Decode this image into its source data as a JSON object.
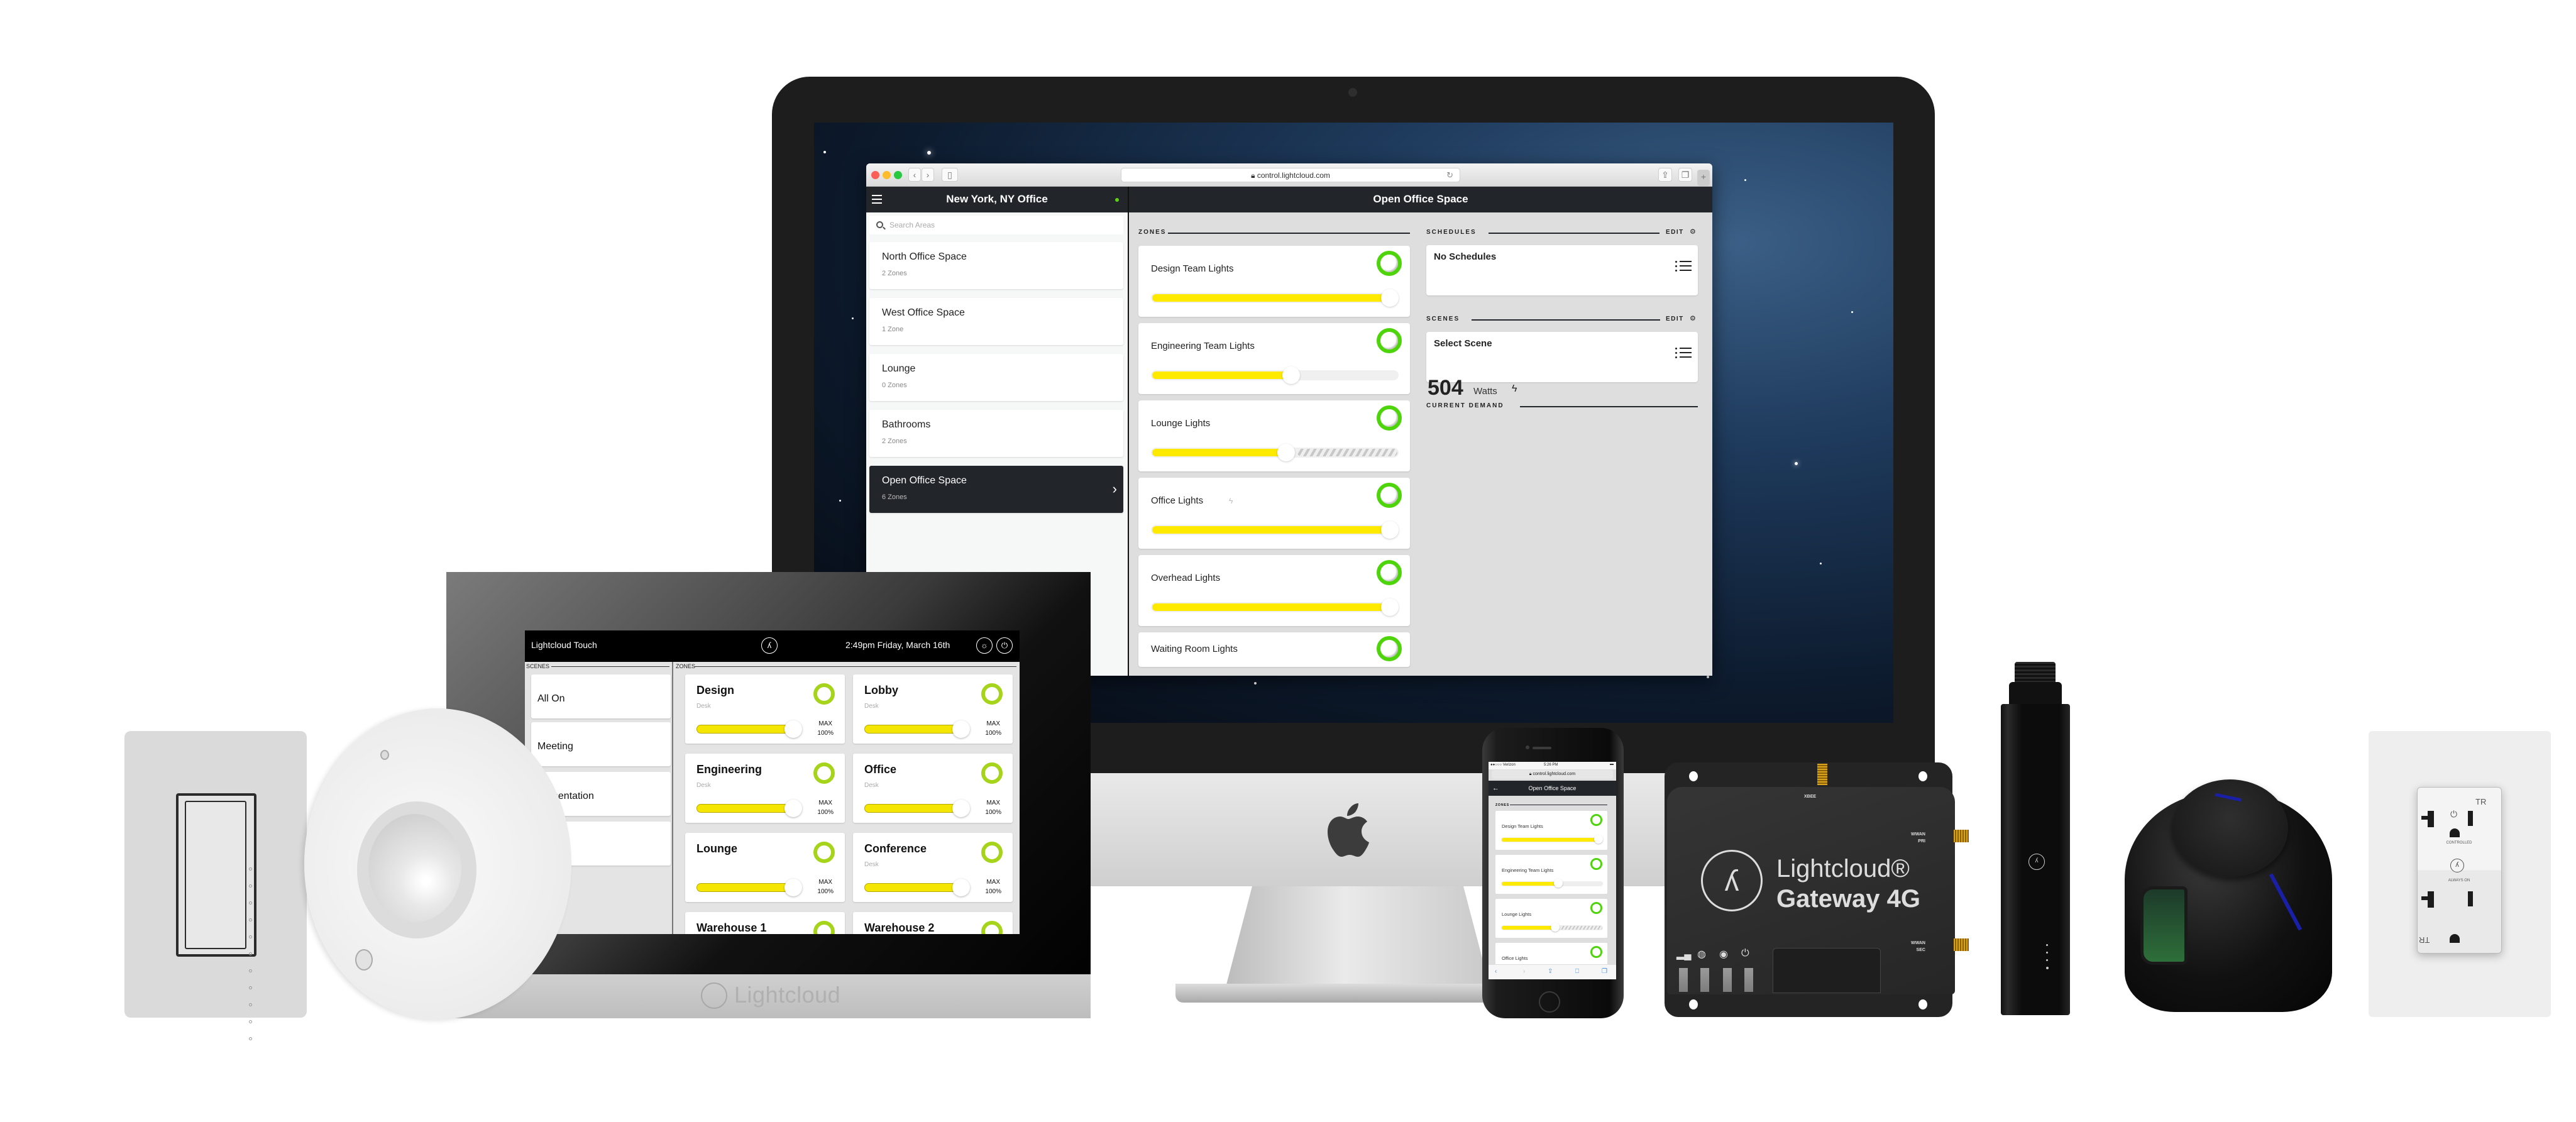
{
  "desktop_browser": {
    "url": "control.lightcloud.com",
    "site_title": "New York, NY Office",
    "connection_status_color": "#5fd312",
    "area_title": "Open Office Space",
    "search": {
      "placeholder": "Search Areas"
    },
    "areas": [
      {
        "name": "North Office Space",
        "zones": "2 Zones",
        "active": false
      },
      {
        "name": "West Office Space",
        "zones": "1 Zone",
        "active": false
      },
      {
        "name": "Lounge",
        "zones": "0 Zones",
        "active": false
      },
      {
        "name": "Bathrooms",
        "zones": "2 Zones",
        "active": false
      },
      {
        "name": "Open Office Space",
        "zones": "6 Zones",
        "active": true
      }
    ],
    "zones_label": "ZONES",
    "zones": [
      {
        "name": "Design Team Lights",
        "level_percent": 100,
        "limit_percent": null,
        "on": true,
        "power_icon": false
      },
      {
        "name": "Engineering Team Lights",
        "level_percent": 58,
        "limit_percent": null,
        "on": true,
        "power_icon": false
      },
      {
        "name": "Lounge Lights",
        "level_percent": 56,
        "limit_percent": 56,
        "on": true,
        "power_icon": false
      },
      {
        "name": "Office Lights",
        "level_percent": 100,
        "limit_percent": null,
        "on": true,
        "power_icon": true
      },
      {
        "name": "Overhead Lights",
        "level_percent": 100,
        "limit_percent": null,
        "on": true,
        "power_icon": false
      },
      {
        "name": "Waiting Room Lights",
        "level_percent": null,
        "limit_percent": null,
        "on": true,
        "power_icon": false
      }
    ],
    "schedules": {
      "label": "SCHEDULES",
      "edit_label": "EDIT",
      "card_title": "No Schedules"
    },
    "scenes": {
      "label": "SCENES",
      "edit_label": "EDIT",
      "card_title": "Select Scene"
    },
    "current_demand": {
      "label": "CURRENT DEMAND",
      "value": "504",
      "unit": "Watts"
    },
    "accent_colors": {
      "slider_fill": "#fee900",
      "on_ring": "#4ed40a",
      "header_bg": "#22262b"
    }
  },
  "touch_panel": {
    "title": "Lightcloud Touch",
    "datetime": "2:49pm Friday, March 16th",
    "scenes_label": "SCENES",
    "zones_label": "ZONES",
    "scenes": [
      "All On",
      "Meeting",
      "Presentation",
      ""
    ],
    "zones": [
      {
        "name": "Design",
        "sub": "Desk",
        "max_label": "MAX",
        "level": "100%"
      },
      {
        "name": "Lobby",
        "sub": "Desk",
        "max_label": "MAX",
        "level": "100%"
      },
      {
        "name": "Engineering",
        "sub": "Desk",
        "max_label": "MAX",
        "level": "100%"
      },
      {
        "name": "Office",
        "sub": "Desk",
        "max_label": "MAX",
        "level": "100%"
      },
      {
        "name": "Lounge",
        "sub": "",
        "max_label": "MAX",
        "level": "100%"
      },
      {
        "name": "Conference",
        "sub": "Desk",
        "max_label": "MAX",
        "level": "100%"
      },
      {
        "name": "Warehouse 1",
        "sub": "",
        "max_label": "",
        "level": ""
      },
      {
        "name": "Warehouse 2",
        "sub": "",
        "max_label": "",
        "level": ""
      }
    ],
    "brand": "Lightcloud"
  },
  "phone": {
    "carrier": "●●○○○ Verizon",
    "time": "5:26 PM",
    "url": "control.lightcloud.com",
    "title": "Open Office Space",
    "zones_label": "ZONES",
    "zones": [
      {
        "name": "Design Team Lights",
        "level_percent": 100,
        "limit_percent": null
      },
      {
        "name": "Engineering Team Lights",
        "level_percent": 58,
        "limit_percent": null
      },
      {
        "name": "Lounge Lights",
        "level_percent": 55,
        "limit_percent": 55
      },
      {
        "name": "Office Lights",
        "level_percent": null,
        "limit_percent": null
      }
    ]
  },
  "gateway": {
    "brand": "Lightcloud®",
    "model": "Gateway 4G",
    "port_top": "XBEE",
    "port_right_1": "WWAN\nPRI",
    "port_right_2": "WWAN\nSEC"
  },
  "receptacle": {
    "top_label": "CONTROLLED",
    "bottom_label": "ALWAYS ON",
    "tr_mark": "TR"
  },
  "icons": {
    "menu": "hamburger-icon",
    "search": "search-icon",
    "chevron": "chevron-right-icon",
    "gear": "gear-icon",
    "list": "list-icon",
    "bolt": "lightning-bolt-icon",
    "power": "power-icon",
    "brightness": "brightness-icon"
  }
}
